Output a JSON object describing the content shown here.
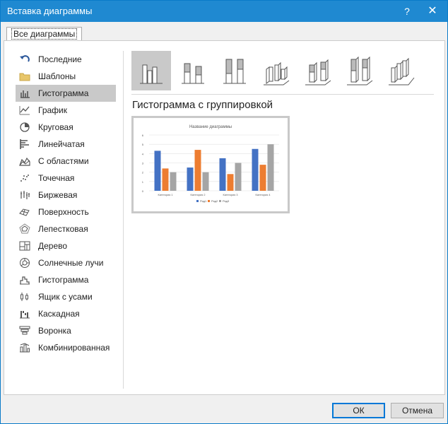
{
  "window": {
    "title": "Вставка диаграммы",
    "help_glyph": "?",
    "close_glyph": "✕"
  },
  "tabs": [
    {
      "label": "Все диаграммы"
    }
  ],
  "sidebar": {
    "items": [
      {
        "label": "Последние",
        "icon": "undo-arrow-icon"
      },
      {
        "label": "Шаблоны",
        "icon": "folder-icon"
      },
      {
        "label": "Гистограмма",
        "icon": "column-chart-icon",
        "selected": true
      },
      {
        "label": "График",
        "icon": "line-chart-icon"
      },
      {
        "label": "Круговая",
        "icon": "pie-chart-icon"
      },
      {
        "label": "Линейчатая",
        "icon": "bar-chart-icon"
      },
      {
        "label": "С областями",
        "icon": "area-chart-icon"
      },
      {
        "label": "Точечная",
        "icon": "scatter-chart-icon"
      },
      {
        "label": "Биржевая",
        "icon": "stock-chart-icon"
      },
      {
        "label": "Поверхность",
        "icon": "surface-chart-icon"
      },
      {
        "label": "Лепестковая",
        "icon": "radar-chart-icon"
      },
      {
        "label": "Дерево",
        "icon": "treemap-chart-icon"
      },
      {
        "label": "Солнечные лучи",
        "icon": "sunburst-chart-icon"
      },
      {
        "label": "Гистограмма",
        "icon": "histogram-chart-icon"
      },
      {
        "label": "Ящик с усами",
        "icon": "box-whisker-chart-icon"
      },
      {
        "label": "Каскадная",
        "icon": "waterfall-chart-icon"
      },
      {
        "label": "Воронка",
        "icon": "funnel-chart-icon"
      },
      {
        "label": "Комбинированная",
        "icon": "combo-chart-icon"
      }
    ]
  },
  "subtypes": [
    {
      "icon": "clustered-column-icon",
      "selected": true
    },
    {
      "icon": "stacked-column-icon"
    },
    {
      "icon": "stacked-100-column-icon"
    },
    {
      "icon": "3d-clustered-column-icon"
    },
    {
      "icon": "3d-stacked-column-icon"
    },
    {
      "icon": "3d-stacked-100-column-icon"
    },
    {
      "icon": "3d-column-icon"
    }
  ],
  "subtype_title": "Гистограмма с группировкой",
  "colors": {
    "series1": "#4472c4",
    "series2": "#ed7d31",
    "series3": "#a5a5a5",
    "titlebar": "#1f89d1"
  },
  "chart_data": {
    "type": "bar",
    "title": "Название диаграммы",
    "categories": [
      "Категория 1",
      "Категория 2",
      "Категория 3",
      "Категория 4"
    ],
    "series": [
      {
        "name": "Ряд1",
        "values": [
          4.3,
          2.5,
          3.5,
          4.5
        ]
      },
      {
        "name": "Ряд2",
        "values": [
          2.4,
          4.4,
          1.8,
          2.8
        ]
      },
      {
        "name": "Ряд3",
        "values": [
          2,
          2,
          3,
          5
        ]
      }
    ],
    "ylim": [
      0,
      6
    ],
    "yticks": [
      0,
      1,
      2,
      3,
      4,
      5,
      6
    ],
    "grid": true,
    "legend": "bottom"
  },
  "buttons": {
    "ok": "ОК",
    "cancel": "Отмена"
  }
}
